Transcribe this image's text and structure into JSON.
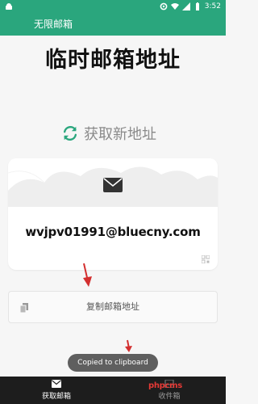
{
  "status_bar": {
    "time": "3:52",
    "icons": [
      "android-icon",
      "settings-icon",
      "wifi-icon",
      "signal-icon",
      "battery-icon"
    ]
  },
  "app_bar": {
    "title": "无限邮箱"
  },
  "main": {
    "title": "临时邮箱地址",
    "refresh_label": "获取新地址",
    "email_address": "wvjpv01991@bluecny.com",
    "copy_button_label": "复制邮箱地址"
  },
  "toast": {
    "text": "Copied to clipboard"
  },
  "bottom_nav": {
    "items": [
      {
        "label": "获取邮箱",
        "icon": "mail-icon",
        "active": true
      },
      {
        "label": "收件箱",
        "icon": "inbox-icon",
        "active": false
      }
    ]
  },
  "watermark": {
    "text": "phpcms"
  },
  "colors": {
    "primary": "#2aa67d",
    "arrow": "#d32f2f",
    "bottom_nav_bg": "#1d1d1d",
    "toast_bg": "#5f5f5f"
  }
}
